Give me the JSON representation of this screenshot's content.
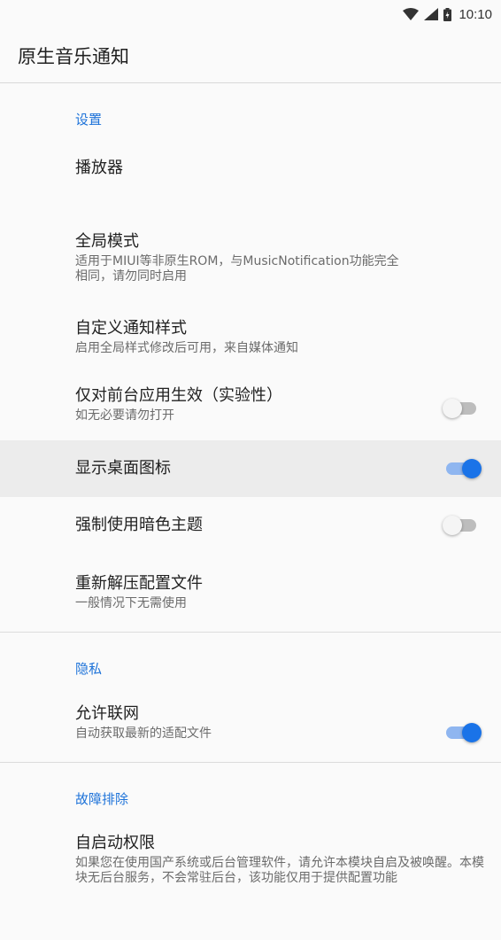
{
  "status_bar": {
    "time": "10:10",
    "icons": [
      "wifi-icon",
      "signal-icon",
      "battery-icon"
    ]
  },
  "app_bar": {
    "title": "原生音乐通知"
  },
  "sections": {
    "settings": {
      "header": "设置",
      "items": [
        {
          "title": "播放器"
        },
        {
          "title": "全局模式",
          "summary": "适用于MIUI等非原生ROM，与MusicNotification功能完全相同，请勿同时启用"
        },
        {
          "title": "自定义通知样式",
          "summary": "启用全局样式修改后可用，来自媒体通知"
        },
        {
          "title": "仅对前台应用生效（实验性）",
          "summary": "如无必要请勿打开",
          "switch": false
        },
        {
          "title": "显示桌面图标",
          "switch": true
        },
        {
          "title": "强制使用暗色主题",
          "switch": false
        },
        {
          "title": "重新解压配置文件",
          "summary": "一般情况下无需使用"
        }
      ]
    },
    "privacy": {
      "header": "隐私",
      "items": [
        {
          "title": "允许联网",
          "summary": "自动获取最新的适配文件",
          "switch": true
        }
      ]
    },
    "troubleshoot": {
      "header": "故障排除",
      "items": [
        {
          "title": "自启动权限",
          "summary": "如果您在使用国产系统或后台管理软件，请允许本模块自启及被唤醒。本模块无后台服务，不会常驻后台，该功能仅用于提供配置功能"
        }
      ]
    }
  },
  "colors": {
    "accent": "#1a73e8",
    "header_text": "#1e73d9",
    "active_row": "#ececec"
  }
}
